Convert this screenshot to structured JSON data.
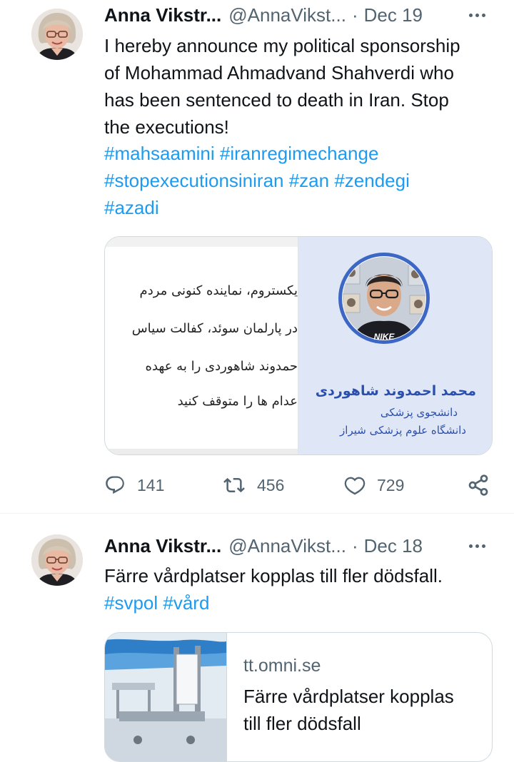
{
  "tweets": [
    {
      "author_name": "Anna Vikstr...",
      "handle": "@AnnaVikst...",
      "separator": "·",
      "date": "Dec 19",
      "text_lines": [
        "I hereby announce my political sponsorship",
        "of Mohammad Ahmadvand Shahverdi  who",
        "has been sentenced to death in Iran. Stop",
        "the executions!"
      ],
      "hashtag_lines": [
        "#mahsaamini #iranregimechange",
        "#stopexecutionsiniran #zan #zendegi",
        "#azadi"
      ],
      "card": {
        "persian_lines": [
          "یکستروم، نماینده کنونی مردم",
          "در پارلمان سوئد، کفالت سیاس",
          "حمدوند شاهوردی را به عهده",
          "عدام ها را متوقف کنید"
        ],
        "person_name": "محمد احمدوند شاهوردی",
        "person_role": "دانشجوی پزشکی",
        "person_school": "دانشگاه علوم پزشکی شیراز",
        "shirt_text": "NIKE"
      },
      "replies": "141",
      "retweets": "456",
      "likes": "729"
    },
    {
      "author_name": "Anna Vikstr...",
      "handle": "@AnnaVikst...",
      "separator": "·",
      "date": "Dec 18",
      "text": "Färre vårdplatser kopplas till fler dödsfall.",
      "hashtags": "#svpol #vård",
      "link_card": {
        "domain": "tt.omni.se",
        "title_lines": [
          "Färre vårdplatser kopplas",
          "till fler dödsfall"
        ]
      }
    }
  ],
  "colors": {
    "text": "#0f1419",
    "secondary": "#536471",
    "link": "#1d9bf0",
    "border": "#cfd9de",
    "card_bg": "#dfe6f6"
  },
  "icons": [
    "reply-icon",
    "retweet-icon",
    "like-icon",
    "share-icon",
    "more-icon"
  ]
}
